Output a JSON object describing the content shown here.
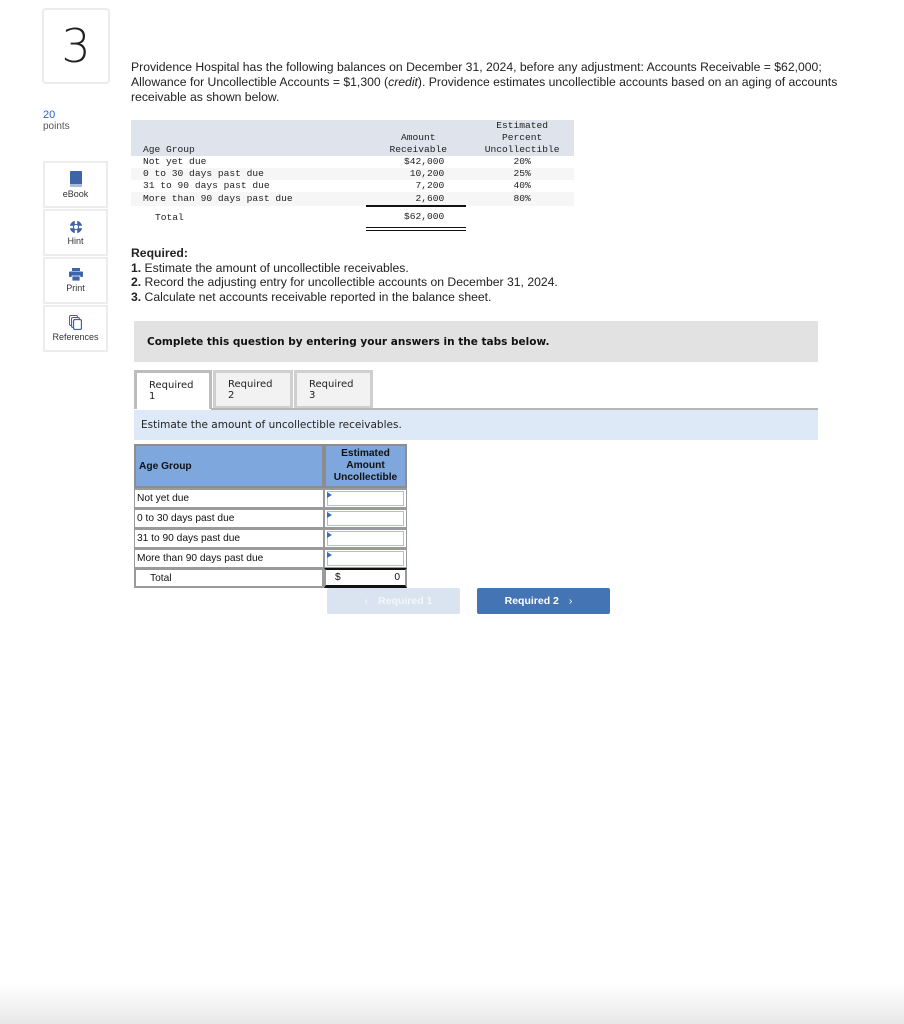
{
  "question": {
    "number": "3",
    "points_value": "20",
    "points_label": "points"
  },
  "tools": [
    {
      "label": "eBook",
      "icon": "book-icon"
    },
    {
      "label": "Hint",
      "icon": "lifebuoy-icon"
    },
    {
      "label": "Print",
      "icon": "printer-icon"
    },
    {
      "label": "References",
      "icon": "documents-icon"
    }
  ],
  "intro": {
    "text_before": "Providence Hospital has the following balances on December 31, 2024, before any adjustment: Accounts Receivable = $62,000; Allowance for Uncollectible Accounts = $1,300 (",
    "text_em": "credit",
    "text_after": "). Providence estimates uncollectible accounts based on an aging of accounts receivable as shown below."
  },
  "aging_table": {
    "headers": {
      "age_group": "Age Group",
      "amount_line1": "Amount",
      "amount_line2": "Receivable",
      "pct_line1": "Estimated",
      "pct_line2": "Percent",
      "pct_line3": "Uncollectible"
    },
    "rows": [
      {
        "group": "Not yet due",
        "amount": "$42,000",
        "percent": "20%"
      },
      {
        "group": "0 to 30 days past due",
        "amount": "10,200",
        "percent": "25%"
      },
      {
        "group": "31 to 90 days past due",
        "amount": "7,200",
        "percent": "40%"
      },
      {
        "group": "More than 90 days past due",
        "amount": "2,600",
        "percent": "80%"
      }
    ],
    "total_label": "Total",
    "total_amount": "$62,000"
  },
  "required": {
    "heading": "Required:",
    "items": [
      {
        "num": "1.",
        "text": " Estimate the amount of uncollectible receivables."
      },
      {
        "num": "2.",
        "text": " Record the adjusting entry for uncollectible accounts on December 31, 2024."
      },
      {
        "num": "3.",
        "text": " Calculate net accounts receivable reported in the balance sheet."
      }
    ]
  },
  "instruction": "Complete this question by entering your answers in the tabs below.",
  "tabs": [
    {
      "label": "Required 1",
      "active": true
    },
    {
      "label": "Required 2",
      "active": false
    },
    {
      "label": "Required 3",
      "active": false
    }
  ],
  "tab_description": "Estimate the amount of uncollectible receivables.",
  "answer_table": {
    "header_group": "Age Group",
    "header_amount_line1": "Estimated",
    "header_amount_line2": "Amount",
    "header_amount_line3": "Uncollectible",
    "rows": [
      {
        "label": "Not yet due",
        "value": ""
      },
      {
        "label": "0 to 30 days past due",
        "value": ""
      },
      {
        "label": "31 to 90 days past due",
        "value": ""
      },
      {
        "label": "More than 90 days past due",
        "value": ""
      }
    ],
    "total_label": "Total",
    "total_currency": "$",
    "total_value": "0"
  },
  "nav": {
    "prev_label": "Required 1",
    "next_label": "Required 2",
    "prev_enabled": false,
    "colors": {
      "next_bg": "#4474b3",
      "prev_bg": "#dae4f0"
    }
  }
}
